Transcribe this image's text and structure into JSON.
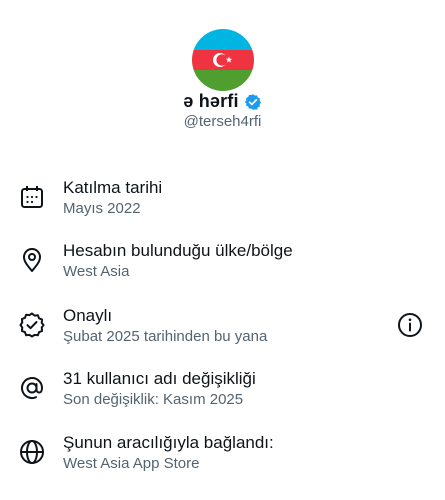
{
  "profile": {
    "display_name": "ə hərfi",
    "handle": "@terseh4rfi",
    "avatar_icon": "azerbaijan-flag",
    "verified_icon": "verified-badge-icon",
    "accent_color": "#1d9bf0"
  },
  "items": [
    {
      "icon": "calendar-icon",
      "title": "Katılma tarihi",
      "subtitle": "Mayıs 2022"
    },
    {
      "icon": "location-pin-icon",
      "title": "Hesabın bulunduğu ülke/bölge",
      "subtitle": "West Asia"
    },
    {
      "icon": "verified-seal-icon",
      "title": "Onaylı",
      "subtitle": "Şubat 2025 tarihinden bu yana",
      "info_icon": "info-icon"
    },
    {
      "icon": "at-sign-icon",
      "title": "31 kullanıcı adı değişikliği",
      "subtitle": "Son değişiklik: Kasım 2025"
    },
    {
      "icon": "globe-icon",
      "title": "Şunun aracılığıyla bağlandı:",
      "subtitle": "West Asia App Store"
    }
  ]
}
